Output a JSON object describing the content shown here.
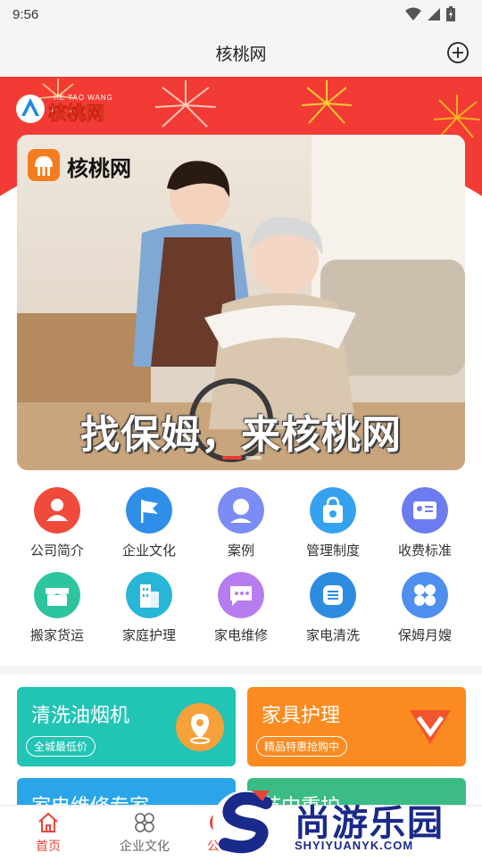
{
  "status": {
    "time": "9:56"
  },
  "header": {
    "title": "核桃网"
  },
  "top_logo": {
    "text": "核桃网",
    "pinyin": "HE TAO WANG"
  },
  "carousel": {
    "logo_text": "核桃网",
    "slogan": "找保姆，来核桃网",
    "active_index": 0
  },
  "grid": [
    {
      "label": "公司简介",
      "icon": "person-badge-icon",
      "color": "#f04a3b"
    },
    {
      "label": "企业文化",
      "icon": "flag-icon",
      "color": "#2f8fe8"
    },
    {
      "label": "案例",
      "icon": "user-case-icon",
      "color": "#7c8cf5"
    },
    {
      "label": "管理制度",
      "icon": "shopping-bag-icon",
      "color": "#35a2f0"
    },
    {
      "label": "收费标准",
      "icon": "id-card-icon",
      "color": "#6c7cf0"
    },
    {
      "label": "搬家货运",
      "icon": "storefront-icon",
      "color": "#2dc59e"
    },
    {
      "label": "家庭护理",
      "icon": "building-icon",
      "color": "#29b5d8"
    },
    {
      "label": "家电维修",
      "icon": "chat-icon",
      "color": "#b77df0"
    },
    {
      "label": "家电清洗",
      "icon": "list-icon",
      "color": "#2e8ce0"
    },
    {
      "label": "保姆月嫂",
      "icon": "grid-flower-icon",
      "color": "#4e8ff0"
    }
  ],
  "cards": [
    {
      "title": "清洗油烟机",
      "tag": "全城最低价",
      "color": "#21c4b5"
    },
    {
      "title": "家具护理",
      "tag": "精品特惠抢购中",
      "color": "#fb8b20"
    },
    {
      "title": "家电维修专家",
      "tag": "",
      "color": "#2aa6e8"
    },
    {
      "title": "节中重护",
      "tag": "",
      "color": "#3bbc86"
    }
  ],
  "tabs": [
    {
      "label": "首页",
      "icon": "home-icon",
      "active": true
    },
    {
      "label": "企业文化",
      "icon": "grid-flower-icon",
      "active": false
    },
    {
      "label": "公司",
      "icon": "company-icon",
      "active": false
    }
  ],
  "watermark": {
    "text": "尚游乐园",
    "url": "SHYIYUANYK.COM"
  },
  "colors": {
    "accent": "#f23b35",
    "tab_active": "#e9433a",
    "tab_inactive": "#666666"
  }
}
